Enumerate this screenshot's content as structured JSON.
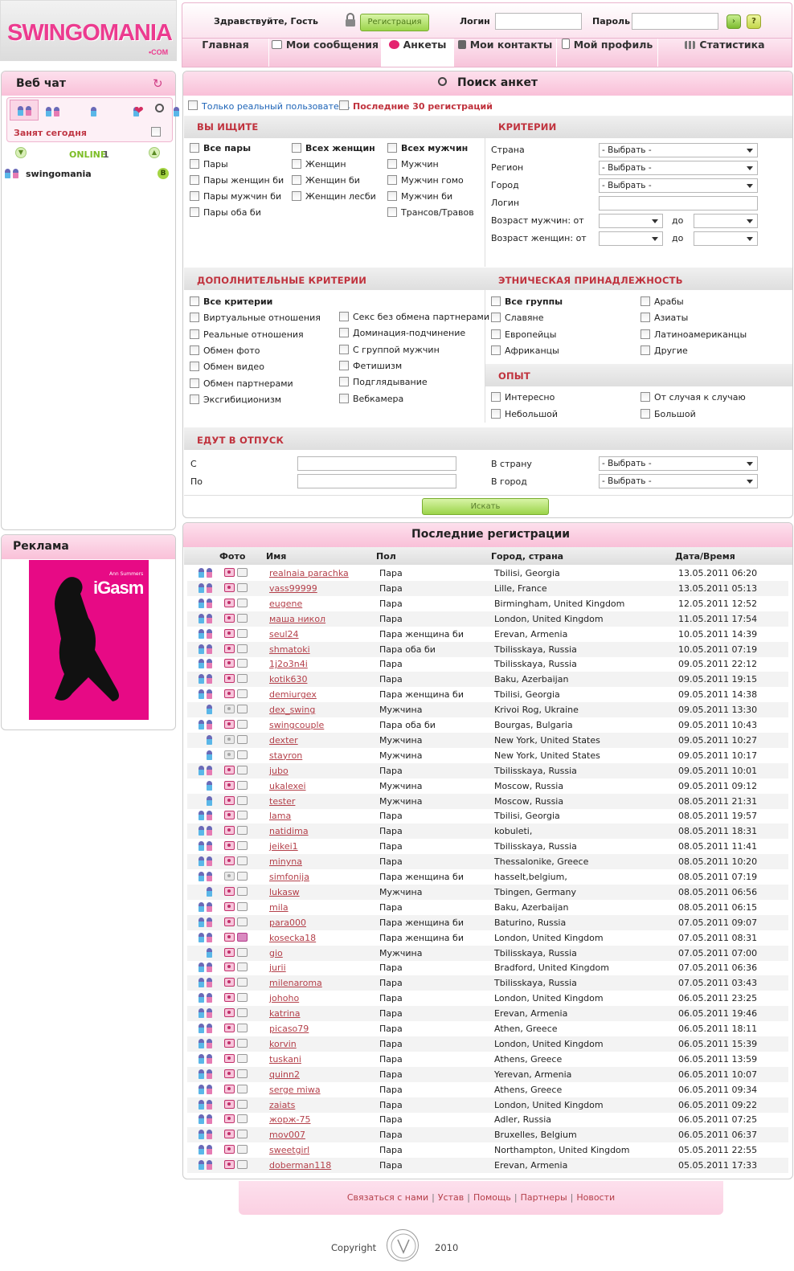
{
  "brand": {
    "logo_text": "SWINGOMANIA",
    "logo_suffix": "•COM"
  },
  "header": {
    "greeting": "Здравствуйте, Гость",
    "register_label": "Регистрация",
    "login_label": "Логин",
    "password_label": "Пароль",
    "login_value": "",
    "password_value": ""
  },
  "nav": [
    {
      "label": "Главная",
      "icon": "home"
    },
    {
      "label": "Мои сообщения",
      "icon": "envelope-icon"
    },
    {
      "label": "Анкеты",
      "icon": "lips-icon",
      "active": true
    },
    {
      "label": "Мои контакты",
      "icon": "contacts-icon"
    },
    {
      "label": "Мой профиль",
      "icon": "profile-doc-icon"
    },
    {
      "label": "Статистика",
      "icon": "chart-icon"
    }
  ],
  "chat": {
    "title": "Веб чат",
    "busy_label": "Занят сегодня",
    "online_label": "ONLINE",
    "online_count": "1",
    "users": [
      {
        "name": "swingomania",
        "badge": "B"
      }
    ]
  },
  "ads": {
    "title": "Реклама",
    "banner_text": "iGasm",
    "banner_sub": "Ann Summers"
  },
  "search": {
    "title": "Поиск анкет",
    "only_real": "Только реальный пользователь",
    "last30": "Последние 30 регистраций",
    "looking_head": "ВЫ ИЩИТЕ",
    "looking": [
      [
        "Все пары",
        "Всех женщин",
        "Всех мужчин"
      ],
      [
        "Пары",
        "Женщин",
        "Мужчин"
      ],
      [
        "Пары женщин би",
        "Женщин би",
        "Мужчин гомо"
      ],
      [
        "Пары мужчин би",
        "Женщин лесби",
        "Мужчин би"
      ],
      [
        "Пары оба би",
        "",
        "Трансов/Травов"
      ]
    ],
    "criteria_head": "КРИТЕРИИ",
    "criteria": {
      "country_label": "Страна",
      "country_value": "- Выбрать -",
      "region_label": "Регион",
      "region_value": "- Выбрать -",
      "city_label": "Город",
      "city_value": "- Выбрать -",
      "login_label": "Логин",
      "age_men_label": "Возраст мужчин: от",
      "age_women_label": "Возраст женщин: от",
      "to_label": "до"
    },
    "extra_head": "ДОПОЛНИТЕЛЬНЫЕ КРИТЕРИИ",
    "extra_left": [
      "Все критерии",
      "Виртуальные отношения",
      "Реальные отношения",
      "Обмен фото",
      "Обмен видео",
      "Обмен партнерами",
      "Эксгибиционизм"
    ],
    "extra_right": [
      "Секс без обмена партнерами",
      "Доминация-подчинение",
      "С группой мужчин",
      "Фетишизм",
      "Подглядывание",
      "Вебкамера"
    ],
    "ethnic_head": "ЭТНИЧЕСКАЯ ПРИНАДЛЕЖНОСТЬ",
    "ethnic_left": [
      "Все группы",
      "Славяне",
      "Европейцы",
      "Африканцы"
    ],
    "ethnic_right": [
      "Арабы",
      "Азиаты",
      "Латиноамериканцы",
      "Другие"
    ],
    "exp_head": "ОПЫТ",
    "exp": [
      "Интересно",
      "От случая к случаю",
      "Небольшой",
      "Большой"
    ],
    "vacation_head": "ЕДУТ В ОТПУСК",
    "from_label": "С",
    "to2_label": "По",
    "to_country_label": "В страну",
    "to_city_label": "В город",
    "to_country_value": "- Выбрать -",
    "to_city_value": "- Выбрать -",
    "search_button": "Искать"
  },
  "registrations": {
    "title": "Последние регистрации",
    "headers": [
      "Фото",
      "Имя",
      "Пол",
      "Город, страна",
      "Дата/Время"
    ],
    "rows": [
      [
        "p",
        "realnaia parachka",
        "Пара",
        "Tbilisi, Georgia",
        "13.05.2011 06:20"
      ],
      [
        "p",
        "vass99999",
        "Пара",
        "Lille, France",
        "13.05.2011 05:13"
      ],
      [
        "p",
        "eugene",
        "Пара",
        "Birmingham, United Kingdom",
        "12.05.2011 12:52"
      ],
      [
        "p",
        "маша никол",
        "Пара",
        "London, United Kingdom",
        "11.05.2011 17:54"
      ],
      [
        "p",
        "seul24",
        "Пара женщина би",
        "Erevan, Armenia",
        "10.05.2011 14:39"
      ],
      [
        "p",
        "shmatoki",
        "Пара оба би",
        "Tbilisskaya, Russia",
        "10.05.2011 07:19"
      ],
      [
        "p",
        "1j2o3n4i",
        "Пара",
        "Tbilisskaya, Russia",
        "09.05.2011 22:12"
      ],
      [
        "p",
        "kotik630",
        "Пара",
        "Baku, Azerbaijan",
        "09.05.2011 19:15"
      ],
      [
        "p",
        "demiurgex",
        "Пара женщина би",
        "Tbilisi, Georgia",
        "09.05.2011 14:38"
      ],
      [
        "m",
        "dex_swing",
        "Мужчина",
        "Krivoi Rog, Ukraine",
        "09.05.2011 13:30"
      ],
      [
        "p",
        "swingcouple",
        "Пара оба би",
        "Bourgas, Bulgaria",
        "09.05.2011 10:43"
      ],
      [
        "m",
        "dexter",
        "Мужчина",
        "New York, United States",
        "09.05.2011 10:27"
      ],
      [
        "m",
        "stayron",
        "Мужчина",
        "New York, United States",
        "09.05.2011 10:17"
      ],
      [
        "p",
        "jubo",
        "Пара",
        "Tbilisskaya, Russia",
        "09.05.2011 10:01"
      ],
      [
        "m",
        "ukalexei",
        "Мужчина",
        "Moscow, Russia",
        "09.05.2011 09:12"
      ],
      [
        "m",
        "tester",
        "Мужчина",
        "Moscow, Russia",
        "08.05.2011 21:31"
      ],
      [
        "p",
        "lama",
        "Пара",
        "Tbilisi, Georgia",
        "08.05.2011 19:57"
      ],
      [
        "p",
        "natidima",
        "Пара",
        "kobuleti,",
        "08.05.2011 18:31"
      ],
      [
        "p",
        "jeikei1",
        "Пара",
        "Tbilisskaya, Russia",
        "08.05.2011 11:41"
      ],
      [
        "p",
        "minyna",
        "Пара",
        "Thessalonike, Greece",
        "08.05.2011 10:20"
      ],
      [
        "p",
        "simfonija",
        "Пара женщина би",
        "hasselt,belgium,",
        "08.05.2011 07:19"
      ],
      [
        "m",
        "lukasw",
        "Мужчина",
        "Tbingen, Germany",
        "08.05.2011 06:56"
      ],
      [
        "p",
        "mila",
        "Пара",
        "Baku, Azerbaijan",
        "08.05.2011 06:15"
      ],
      [
        "p",
        "para000",
        "Пара женщина би",
        "Baturino, Russia",
        "07.05.2011 09:07"
      ],
      [
        "p",
        "kosecka18",
        "Пара женщина би",
        "London, United Kingdom",
        "07.05.2011 08:31"
      ],
      [
        "m",
        "gio",
        "Мужчина",
        "Tbilisskaya, Russia",
        "07.05.2011 07:00"
      ],
      [
        "p",
        "jurii",
        "Пара",
        "Bradford, United Kingdom",
        "07.05.2011 06:36"
      ],
      [
        "p",
        "milenaroma",
        "Пара",
        "Tbilisskaya, Russia",
        "07.05.2011 03:43"
      ],
      [
        "p",
        "johoho",
        "Пара",
        "London, United Kingdom",
        "06.05.2011 23:25"
      ],
      [
        "p",
        "katrina",
        "Пара",
        "Erevan, Armenia",
        "06.05.2011 19:46"
      ],
      [
        "p",
        "picaso79",
        "Пара",
        "Athen, Greece",
        "06.05.2011 18:11"
      ],
      [
        "p",
        "korvin",
        "Пара",
        "London, United Kingdom",
        "06.05.2011 15:39"
      ],
      [
        "p",
        "tuskani",
        "Пара",
        "Athens, Greece",
        "06.05.2011 13:59"
      ],
      [
        "p",
        "quinn2",
        "Пара",
        "Yerevan, Armenia",
        "06.05.2011 10:07"
      ],
      [
        "p",
        "serge miwa",
        "Пара",
        "Athens, Greece",
        "06.05.2011 09:34"
      ],
      [
        "p",
        "zaiats",
        "Пара",
        "London, United Kingdom",
        "06.05.2011 09:22"
      ],
      [
        "p",
        "жорж-75",
        "Пара",
        "Adler, Russia",
        "06.05.2011 07:25"
      ],
      [
        "p",
        "mov007",
        "Пара",
        "Bruxelles, Belgium",
        "06.05.2011 06:37"
      ],
      [
        "p",
        "sweetgirl",
        "Пара",
        "Northampton, United Kingdom",
        "05.05.2011 22:55"
      ],
      [
        "p",
        "doberman118",
        "Пара",
        "Erevan, Armenia",
        "05.05.2011 17:33"
      ]
    ]
  },
  "footer": {
    "links": [
      "Связаться с нами",
      "Устав",
      "Помощь",
      "Партнеры",
      "Новости"
    ],
    "copyright": "Copyright",
    "year": "2010"
  }
}
